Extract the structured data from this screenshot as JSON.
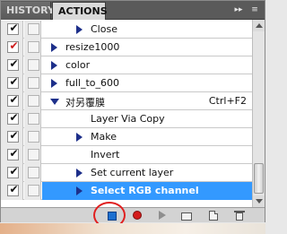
{
  "tabs": [
    {
      "label": "HISTORY"
    },
    {
      "label": "ACTIONS"
    }
  ],
  "tab_controls": {
    "collapse": "▸▸",
    "menu": "≡"
  },
  "rows": [
    {
      "label": "Close",
      "checked": true,
      "red": false,
      "indent": 2,
      "arrow": "right",
      "folder": false,
      "shortcut": ""
    },
    {
      "label": "resize1000",
      "checked": true,
      "red": true,
      "indent": 0,
      "arrow": "right",
      "folder": true,
      "shortcut": ""
    },
    {
      "label": "color",
      "checked": true,
      "red": false,
      "indent": 0,
      "arrow": "right",
      "folder": true,
      "shortcut": ""
    },
    {
      "label": "full_to_600",
      "checked": true,
      "red": false,
      "indent": 0,
      "arrow": "right",
      "folder": true,
      "shortcut": ""
    },
    {
      "label": "对另覆膜",
      "checked": true,
      "red": false,
      "indent": 0,
      "arrow": "down",
      "folder": true,
      "shortcut": "Ctrl+F2"
    },
    {
      "label": "Layer Via Copy",
      "checked": true,
      "red": false,
      "indent": 2,
      "arrow": "none",
      "folder": false,
      "shortcut": ""
    },
    {
      "label": "Make",
      "checked": true,
      "red": false,
      "indent": 2,
      "arrow": "right",
      "folder": false,
      "shortcut": ""
    },
    {
      "label": "Invert",
      "checked": true,
      "red": false,
      "indent": 2,
      "arrow": "none",
      "folder": false,
      "shortcut": ""
    },
    {
      "label": "Set current layer",
      "checked": true,
      "red": false,
      "indent": 2,
      "arrow": "right",
      "folder": false,
      "shortcut": ""
    },
    {
      "label": "Select RGB channel",
      "checked": true,
      "red": false,
      "indent": 2,
      "arrow": "right",
      "folder": false,
      "shortcut": "",
      "selected": true
    }
  ],
  "toolbar": {
    "stop": "stop-icon",
    "record": "record-icon",
    "play": "play-icon",
    "new_set": "folder-icon",
    "new_action": "new-page-icon",
    "delete": "trash-icon"
  },
  "colors": {
    "selection": "#3399ff",
    "stop": "#1c6fd0",
    "record": "#d41c1c",
    "annotation_circle": "#e02020"
  }
}
